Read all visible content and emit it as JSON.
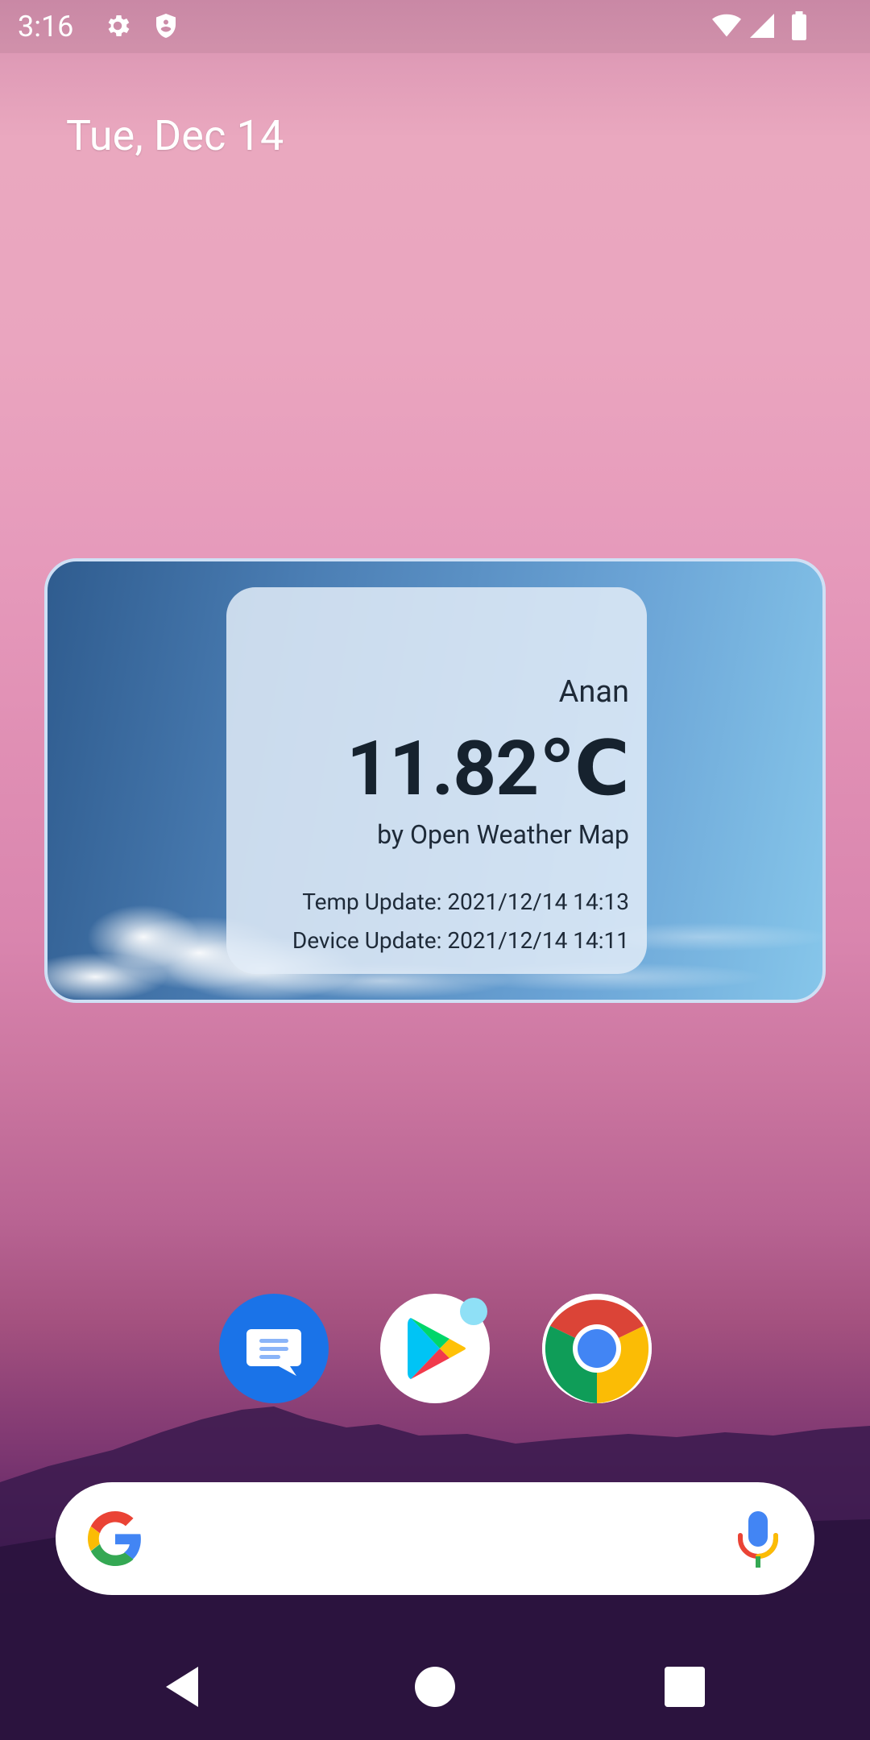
{
  "status_bar": {
    "time": "3:16",
    "left_icons": [
      "gear-icon",
      "shield-icon"
    ],
    "right_icons": [
      "wifi-icon",
      "cell-signal-icon",
      "battery-icon"
    ]
  },
  "home": {
    "date": "Tue, Dec 14"
  },
  "weather_widget": {
    "location": "Anan",
    "temperature": "11.82℃",
    "source": "by Open Weather Map",
    "temp_update": "Temp Update: 2021/12/14 14:13",
    "device_update": "Device Update: 2021/12/14 14:11"
  },
  "dock": {
    "apps": [
      {
        "name": "messages-icon"
      },
      {
        "name": "play-store-icon",
        "has_notification_dot": true
      },
      {
        "name": "chrome-icon"
      }
    ]
  },
  "search_bar": {
    "left_icon": "google-g-icon",
    "right_icon": "microphone-icon"
  },
  "nav_bar": {
    "buttons": [
      "back-icon",
      "home-icon",
      "recents-icon"
    ]
  },
  "colors": {
    "widget_border": "#cfe0f5",
    "card_background": "#e1ebf7",
    "text_dark": "#16222e",
    "notification_dot": "#8fe0f6",
    "messages_blue": "#1a73e8"
  }
}
